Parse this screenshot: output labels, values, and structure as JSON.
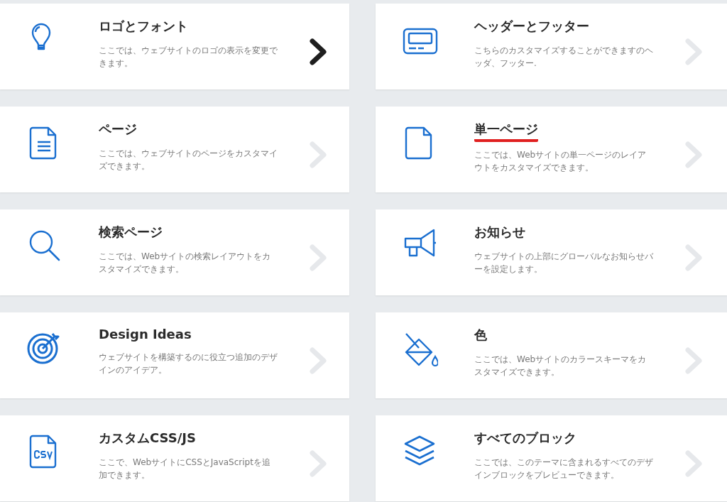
{
  "cards": [
    {
      "title": "ロゴとフォント",
      "description": "ここでは、ウェブサイトのロゴの表示を変更できます。",
      "selected": true,
      "underlined": false
    },
    {
      "title": "ヘッダーとフッター",
      "description": "こちらのカスタマイズすることができますのヘッダ、フッター.",
      "selected": false,
      "underlined": false
    },
    {
      "title": "ページ",
      "description": "ここでは、ウェブサイトのページをカスタマイズできます。",
      "selected": false,
      "underlined": false
    },
    {
      "title": "単一ページ",
      "description": "ここでは、Webサイトの単一ページのレイアウトをカスタマイズできます。",
      "selected": false,
      "underlined": true
    },
    {
      "title": "検索ページ",
      "description": "ここでは、Webサイトの検索レイアウトをカスタマイズできます。",
      "selected": false,
      "underlined": false
    },
    {
      "title": "お知らせ",
      "description": "ウェブサイトの上部にグローバルなお知らせバーを設定します。",
      "selected": false,
      "underlined": false
    },
    {
      "title": "Design Ideas",
      "description": "ウェブサイトを構築するのに役立つ追加のデザインのアイデア。",
      "selected": false,
      "underlined": false
    },
    {
      "title": "色",
      "description": "ここでは、Webサイトのカラースキーマをカスタマイズできます。",
      "selected": false,
      "underlined": false
    },
    {
      "title": "カスタムCSS/JS",
      "description": "ここで、WebサイトにCSSとJavaScriptを追加できます。",
      "selected": false,
      "underlined": false
    },
    {
      "title": "すべてのブロック",
      "description": "ここでは、このテーマに含まれるすべてのデザインブロックをプレビューできます。",
      "selected": false,
      "underlined": false
    }
  ]
}
